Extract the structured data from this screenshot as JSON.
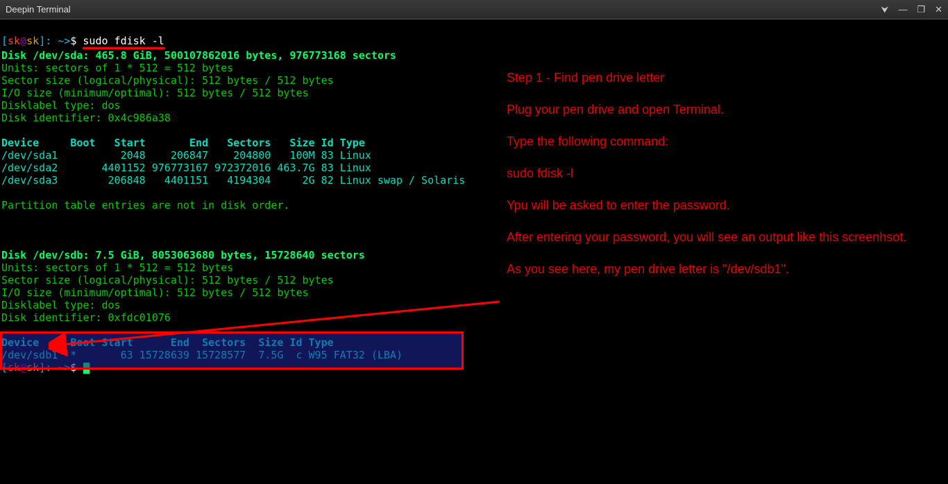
{
  "window": {
    "title": "Deepin Terminal"
  },
  "prompt": {
    "open": "[",
    "user": "sk",
    "at": "@",
    "host": "sk",
    "close": "]",
    "path": ": ~>",
    "dollar": "$"
  },
  "command1": "sudo fdisk -l",
  "disk_a": {
    "header": "Disk /dev/sda: 465.8 GiB, 500107862016 bytes, 976773168 sectors",
    "units": "Units: sectors of 1 * 512 = 512 bytes",
    "sector": "Sector size (logical/physical): 512 bytes / 512 bytes",
    "io": "I/O size (minimum/optimal): 512 bytes / 512 bytes",
    "label": "Disklabel type: dos",
    "ident": "Disk identifier: 0x4c986a38",
    "table_header": "Device     Boot   Start       End   Sectors   Size Id Type",
    "row1": "/dev/sda1          2048    206847    204800   100M 83 Linux",
    "row2": "/dev/sda2       4401152 976773167 972372016 463.7G 83 Linux",
    "row3": "/dev/sda3        206848   4401151   4194304     2G 82 Linux swap / Solaris",
    "note": "Partition table entries are not in disk order."
  },
  "disk_b": {
    "header": "Disk /dev/sdb: 7.5 GiB, 8053063680 bytes, 15728640 sectors",
    "units": "Units: sectors of 1 * 512 = 512 bytes",
    "sector": "Sector size (logical/physical): 512 bytes / 512 bytes",
    "io": "I/O size (minimum/optimal): 512 bytes / 512 bytes",
    "label": "Disklabel type: dos",
    "ident": "Disk identifier: 0xfdc01076",
    "table_header": "Device     Boot Start      End  Sectors  Size Id Type",
    "row1": "/dev/sdb1  *       63 15728639 15728577  7.5G  c W95 FAT32 (LBA)"
  },
  "annotations": {
    "l1": "Step 1 - Find pen drive letter",
    "l2": "Plug your pen drive and open Terminal.",
    "l3": "Type the following command:",
    "l4": "sudo fdisk -l",
    "l5": "Ypu will be asked to enter the password.",
    "l6": "After entering your password, you will see an output like this screenhsot.",
    "l7": "As you see here, my pen drive letter is \"/dev/sdb1\"."
  }
}
